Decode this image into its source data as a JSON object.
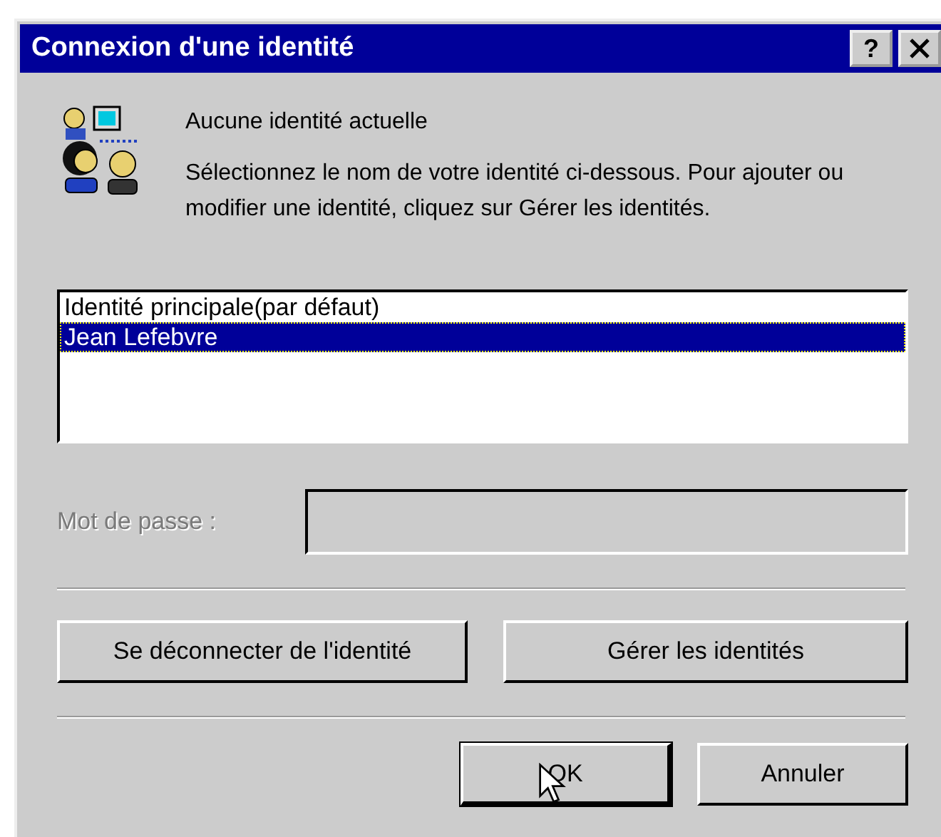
{
  "window": {
    "title": "Connexion d'une identité",
    "help_button": "?"
  },
  "heading": "Aucune identité actuelle",
  "instructions": "Sélectionnez le nom de votre identité ci-dessous. Pour ajouter ou modifier une identité, cliquez sur Gérer les identités.",
  "identities": [
    {
      "name": "Identité principale(par défaut)",
      "selected": false
    },
    {
      "name": "Jean Lefebvre",
      "selected": true
    }
  ],
  "password": {
    "label": "Mot de passe :",
    "disabled": true
  },
  "identity_buttons": [
    "Se déconnecter de l'identité",
    "Gérer les identités"
  ],
  "dialog_buttons": [
    {
      "label": "OK",
      "default": true
    },
    {
      "label": "Annuler",
      "default": false
    }
  ]
}
